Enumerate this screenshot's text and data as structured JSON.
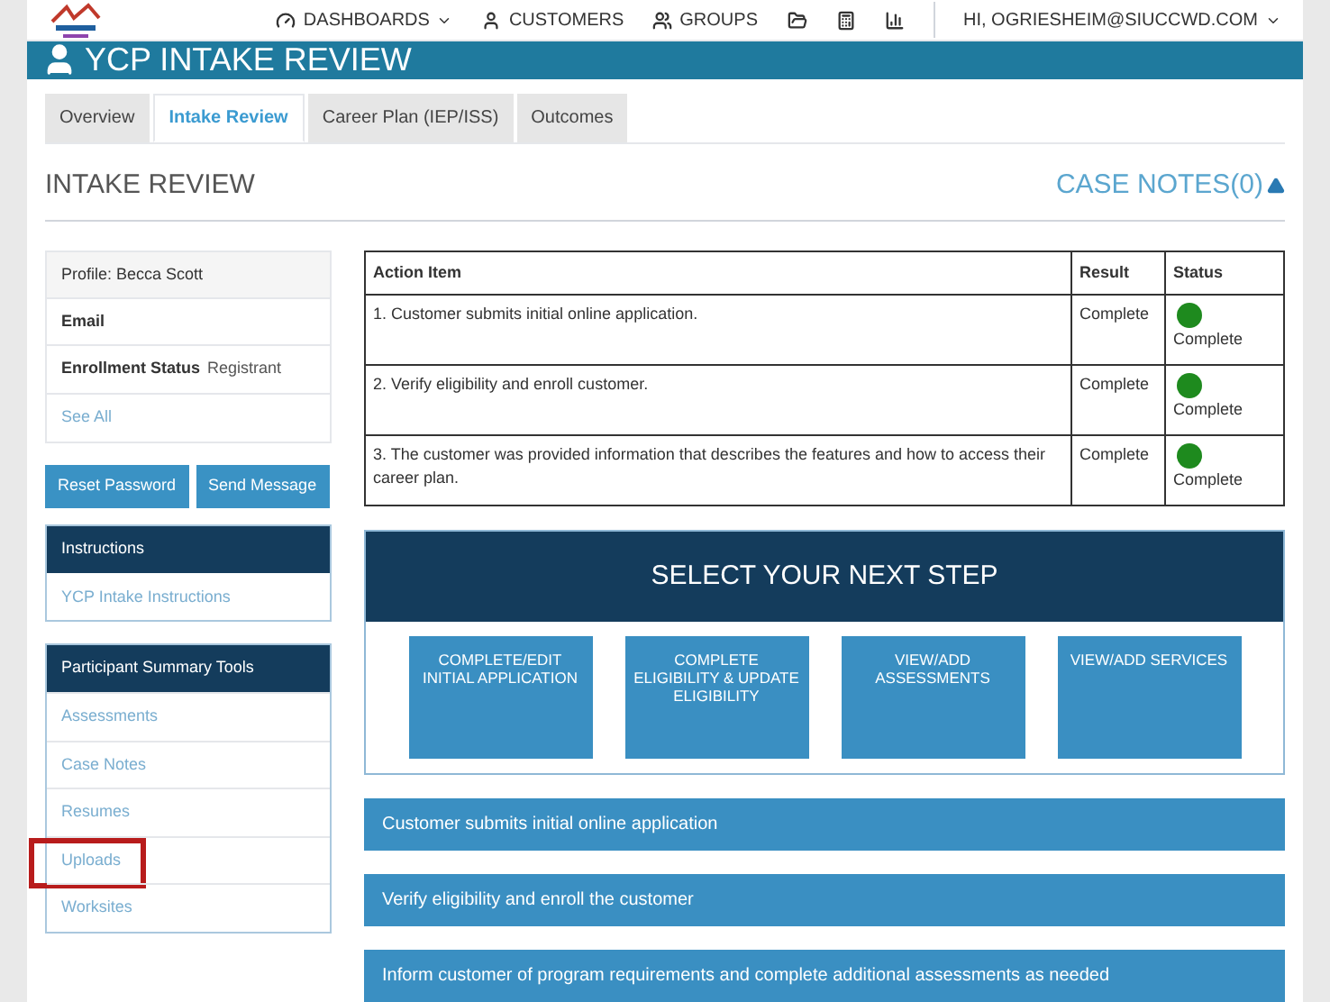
{
  "nav": {
    "items": [
      {
        "label": "DASHBOARDS",
        "kind": "dashboards",
        "dropdown": true
      },
      {
        "label": "CUSTOMERS",
        "kind": "customers",
        "dropdown": false
      },
      {
        "label": "GROUPS",
        "kind": "groups",
        "dropdown": false
      },
      {
        "kind": "folder",
        "dropdown": false
      },
      {
        "kind": "calculator",
        "dropdown": false
      },
      {
        "kind": "chart",
        "dropdown": false
      }
    ],
    "user": "HI, OGRIESHEIM@SIUCCWD.COM"
  },
  "header": {
    "title": "YCP INTAKE REVIEW"
  },
  "tabs": [
    {
      "label": "Overview",
      "selected": false
    },
    {
      "label": "Intake Review",
      "selected": true
    },
    {
      "label": "Career Plan (IEP/ISS)",
      "selected": false
    },
    {
      "label": "Outcomes",
      "selected": false
    }
  ],
  "section": {
    "title": "INTAKE REVIEW",
    "case_notes": "CASE NOTES(0)",
    "expanded": true
  },
  "profile": {
    "name": "Profile: Becca Scott",
    "email_label": "Email",
    "status_label": "Enrollment Status",
    "status_value": "Registrant",
    "see_all": "See All"
  },
  "buttons": [
    "Reset Password",
    "Send Message"
  ],
  "instructions": {
    "title": "Instructions",
    "items": [
      "YCP Intake Instructions"
    ]
  },
  "tools": {
    "title": "Participant Summary Tools",
    "items": [
      {
        "label": "Assessments",
        "highlighted": false
      },
      {
        "label": "Case Notes",
        "highlighted": false
      },
      {
        "label": "Resumes",
        "highlighted": false
      },
      {
        "label": "Uploads",
        "highlighted": true
      },
      {
        "label": "Worksites",
        "highlighted": false
      }
    ]
  },
  "table": {
    "columns": [
      "Action Item",
      "Result",
      "Status"
    ],
    "rows": [
      {
        "action": "1. Customer submits initial online application.",
        "result": "Complete",
        "status": "Complete",
        "color": "#1e8a1e"
      },
      {
        "action": "2. Verify eligibility and enroll customer.",
        "result": "Complete",
        "status": "Complete",
        "color": "#1e8a1e"
      },
      {
        "action": "3. The customer was provided information that describes the features and how to access their career plan.",
        "result": "Complete",
        "status": "Complete",
        "color": "#1e8a1e"
      }
    ]
  },
  "next_step": {
    "title": "SELECT YOUR NEXT STEP",
    "options": [
      "COMPLETE/EDIT INITIAL APPLICATION",
      "COMPLETE ELIGIBILITY & UPDATE ELIGIBILITY",
      "VIEW/ADD ASSESSMENTS",
      "VIEW/ADD SERVICES"
    ]
  },
  "steps": [
    "Customer submits initial online application",
    "Verify eligibility and enroll the customer",
    "Inform customer of program requirements and complete additional assessments as needed"
  ]
}
